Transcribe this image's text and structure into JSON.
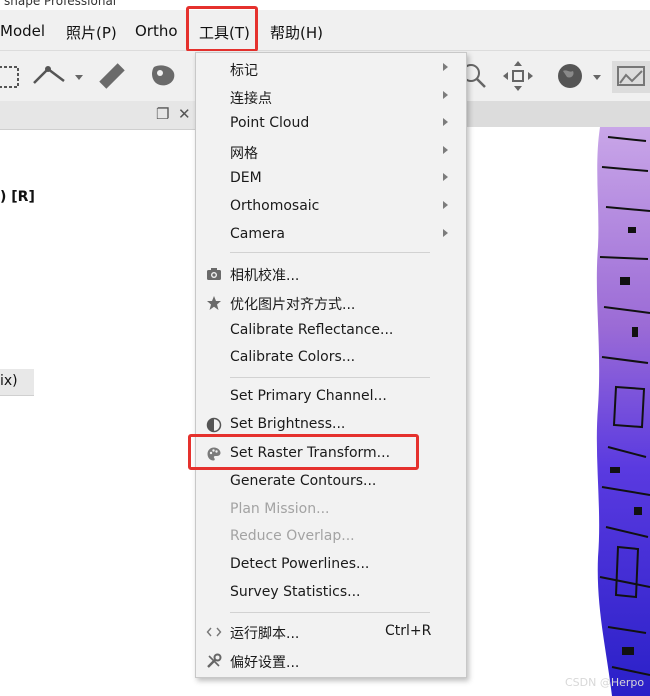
{
  "window": {
    "title": "shape Professional"
  },
  "menubar": {
    "items": [
      {
        "label": "Model"
      },
      {
        "label": "照片(P)"
      },
      {
        "label": "Ortho"
      },
      {
        "label": "工具(T)"
      },
      {
        "label": "帮助(H)"
      }
    ]
  },
  "left_panel": {
    "text1": ") [R]",
    "text2": "ix)"
  },
  "tools_menu": {
    "items": [
      {
        "label": "标记",
        "submenu": true
      },
      {
        "label": "连接点",
        "submenu": true
      },
      {
        "label": "Point Cloud",
        "submenu": true
      },
      {
        "label": "网格",
        "submenu": true
      },
      {
        "label": "DEM",
        "submenu": true
      },
      {
        "label": "Orthomosaic",
        "submenu": true
      },
      {
        "label": "Camera",
        "submenu": true
      },
      {
        "label": "相机校准...",
        "icon": "camera-icon"
      },
      {
        "label": "优化图片对齐方式...",
        "icon": "star-icon"
      },
      {
        "label": "Calibrate Reflectance..."
      },
      {
        "label": "Calibrate Colors..."
      },
      {
        "label": "Set Primary Channel..."
      },
      {
        "label": "Set Brightness...",
        "icon": "half-circle-icon"
      },
      {
        "label": "Set Raster Transform...",
        "icon": "palette-icon"
      },
      {
        "label": "Generate Contours..."
      },
      {
        "label": "Plan Mission...",
        "disabled": true
      },
      {
        "label": "Reduce Overlap...",
        "disabled": true
      },
      {
        "label": "Detect Powerlines..."
      },
      {
        "label": "Survey Statistics..."
      },
      {
        "label": "运行脚本...",
        "shortcut": "Ctrl+R",
        "icon": "code-icon"
      },
      {
        "label": "偏好设置...",
        "icon": "tools-icon"
      }
    ]
  },
  "watermark": "CSDN @Herpo",
  "colors": {
    "highlight": "#e5312d",
    "scene_purple": "#9b6bd6",
    "scene_blue": "#3a2ad8"
  }
}
